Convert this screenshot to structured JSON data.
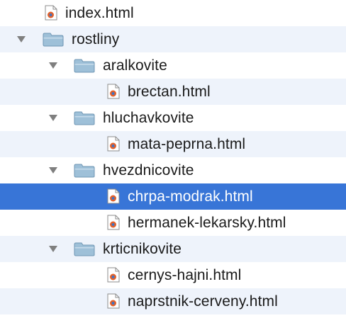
{
  "tree": {
    "items": [
      {
        "label": "index.html",
        "type": "file",
        "level": 0
      },
      {
        "label": "rostliny",
        "type": "folder",
        "level": 0,
        "expanded": true
      },
      {
        "label": "aralkovite",
        "type": "folder",
        "level": 1,
        "expanded": true
      },
      {
        "label": "brectan.html",
        "type": "file",
        "level": 2
      },
      {
        "label": "hluchavkovite",
        "type": "folder",
        "level": 1,
        "expanded": true
      },
      {
        "label": "mata-peprna.html",
        "type": "file",
        "level": 2
      },
      {
        "label": "hvezdnicovite",
        "type": "folder",
        "level": 1,
        "expanded": true
      },
      {
        "label": "chrpa-modrak.html",
        "type": "file",
        "level": 2,
        "selected": true
      },
      {
        "label": "hermanek-lekarsky.html",
        "type": "file",
        "level": 2
      },
      {
        "label": "krticnikovite",
        "type": "folder",
        "level": 1,
        "expanded": true
      },
      {
        "label": "cernys-hajni.html",
        "type": "file",
        "level": 2
      },
      {
        "label": "naprstnik-cerveny.html",
        "type": "file",
        "level": 2
      }
    ]
  },
  "colors": {
    "selection": "#3875d7",
    "alternate_row": "#eef3fb",
    "folder": "#9ec0d8",
    "file_badge": "#e3612a"
  },
  "icons": {
    "file": "html-file-icon",
    "folder": "folder-icon",
    "expanded": "disclosure-triangle-down-icon"
  }
}
